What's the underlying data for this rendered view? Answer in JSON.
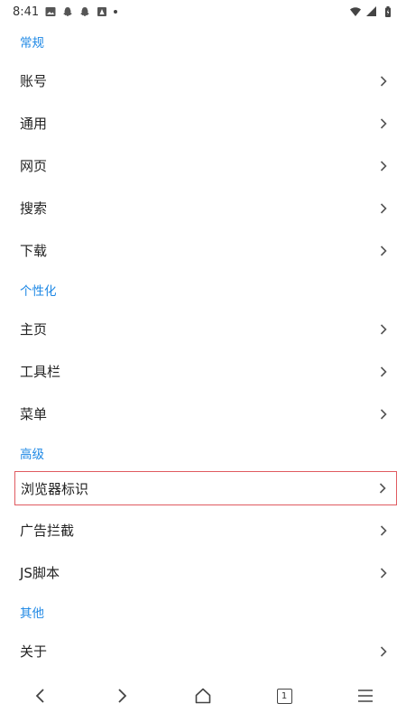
{
  "status_bar": {
    "time": "8:41"
  },
  "sections": [
    {
      "header": "常规",
      "items": [
        "账号",
        "通用",
        "网页",
        "搜索",
        "下载"
      ]
    },
    {
      "header": "个性化",
      "items": [
        "主页",
        "工具栏",
        "菜单"
      ]
    },
    {
      "header": "高级",
      "items": [
        "浏览器标识",
        "广告拦截",
        "JS脚本"
      ]
    },
    {
      "header": "其他",
      "items": [
        "关于"
      ]
    }
  ],
  "bottom_nav": {
    "tab_count": "1"
  },
  "colors": {
    "section_header": "#1e88e5",
    "highlight_border": "#e05a60"
  }
}
